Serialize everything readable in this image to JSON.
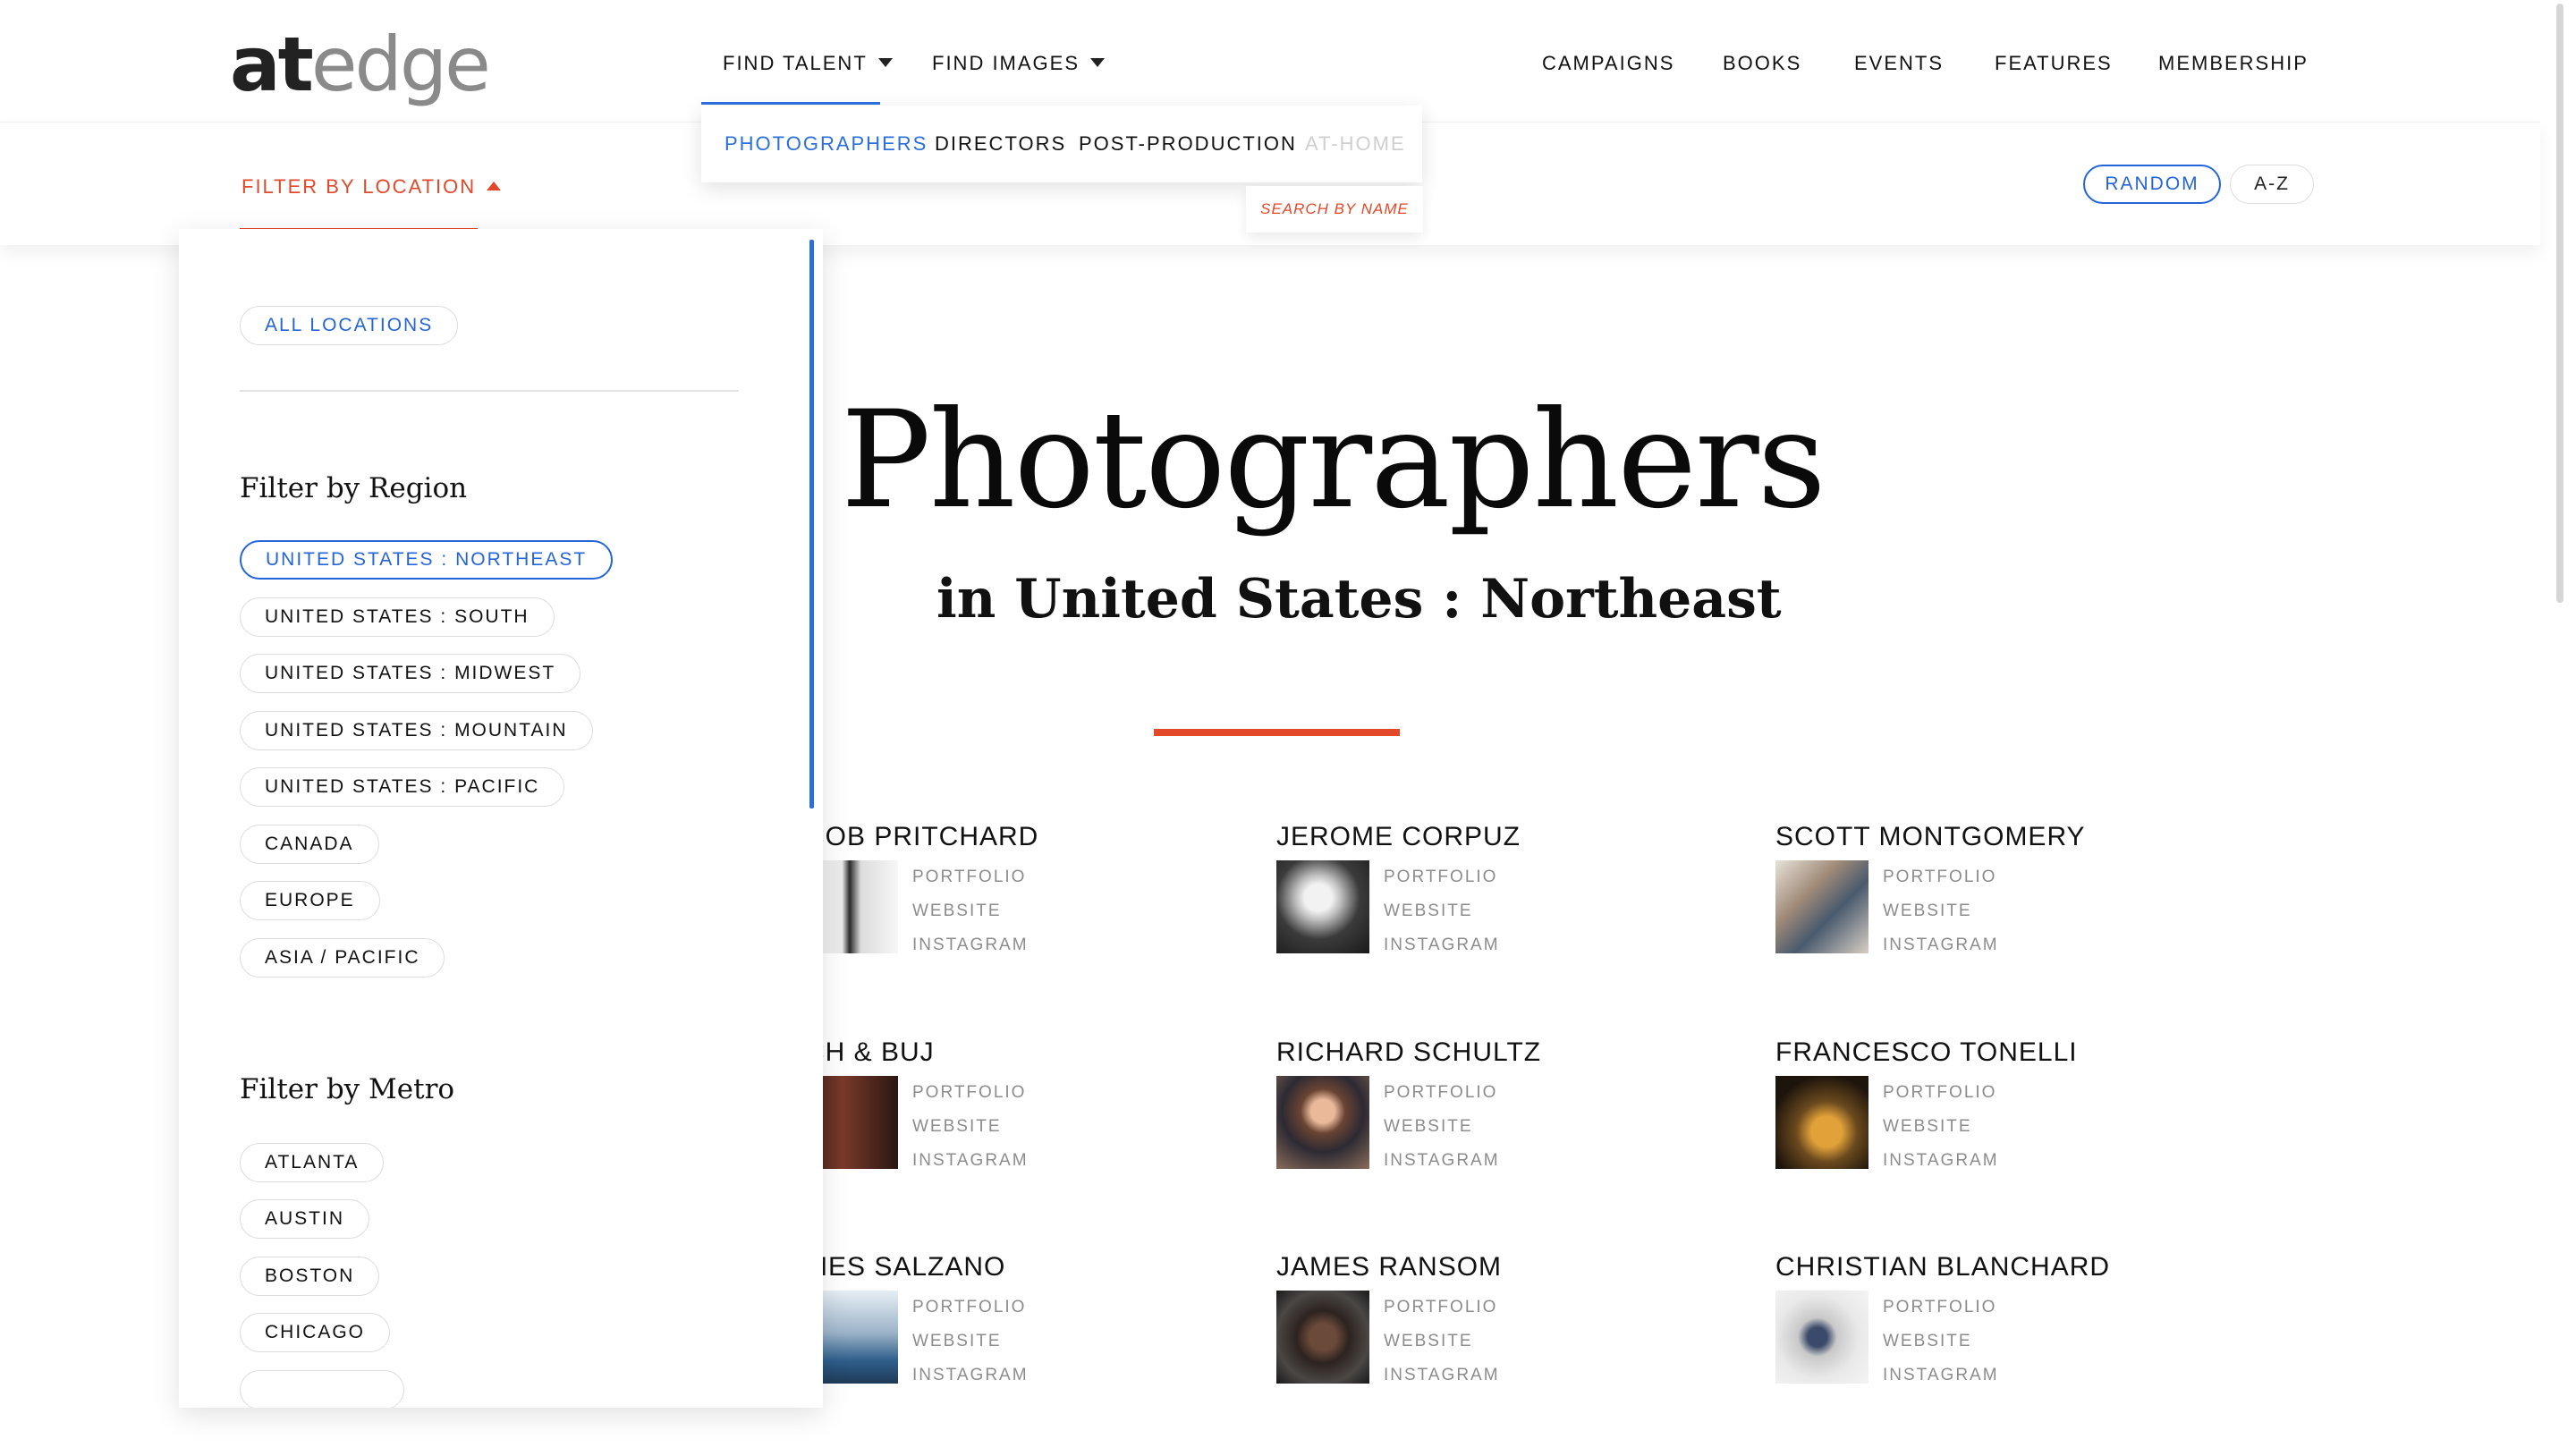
{
  "brand": {
    "logo_at": "at",
    "logo_edge": "edge"
  },
  "nav": {
    "find_talent": "FIND TALENT",
    "find_images": "FIND IMAGES",
    "campaigns": "CAMPAIGNS",
    "books": "BOOKS",
    "events": "EVENTS",
    "features": "FEATURES",
    "membership": "MEMBERSHIP"
  },
  "dropdown": {
    "photographers": "PHOTOGRAPHERS",
    "directors": "DIRECTORS",
    "post_production": "POST-PRODUCTION",
    "at_home": "AT-HOME",
    "search_by_name": "SEARCH BY NAME"
  },
  "subbar": {
    "filter_location": "FILTER BY LOCATION",
    "random": "RANDOM",
    "az": "A-Z"
  },
  "filter_panel": {
    "all_locations": "ALL LOCATIONS",
    "region_heading": "Filter by Region",
    "regions": [
      "UNITED STATES : NORTHEAST",
      "UNITED STATES : SOUTH",
      "UNITED STATES : MIDWEST",
      "UNITED STATES : MOUNTAIN",
      "UNITED STATES : PACIFIC",
      "CANADA",
      "EUROPE",
      "ASIA / PACIFIC"
    ],
    "selected_region": "UNITED STATES : NORTHEAST",
    "metro_heading": "Filter by Metro",
    "metros": [
      "ATLANTA",
      "AUSTIN",
      "BOSTON",
      "CHICAGO"
    ]
  },
  "page": {
    "title": "Photographers",
    "subtitle": "in United States : Northeast"
  },
  "card_links": {
    "portfolio": "PORTFOLIO",
    "website": "WEBSITE",
    "instagram": "INSTAGRAM"
  },
  "photographers": [
    "COB PRITCHARD",
    "JEROME CORPUZ",
    "SCOTT MONTGOMERY",
    "CH & BUJ",
    "RICHARD SCHULTZ",
    "FRANCESCO TONELLI",
    "MES SALZANO",
    "JAMES RANSOM",
    "CHRISTIAN BLANCHARD"
  ],
  "colors": {
    "accent_red": "#e2492a",
    "accent_blue": "#2565d8"
  }
}
